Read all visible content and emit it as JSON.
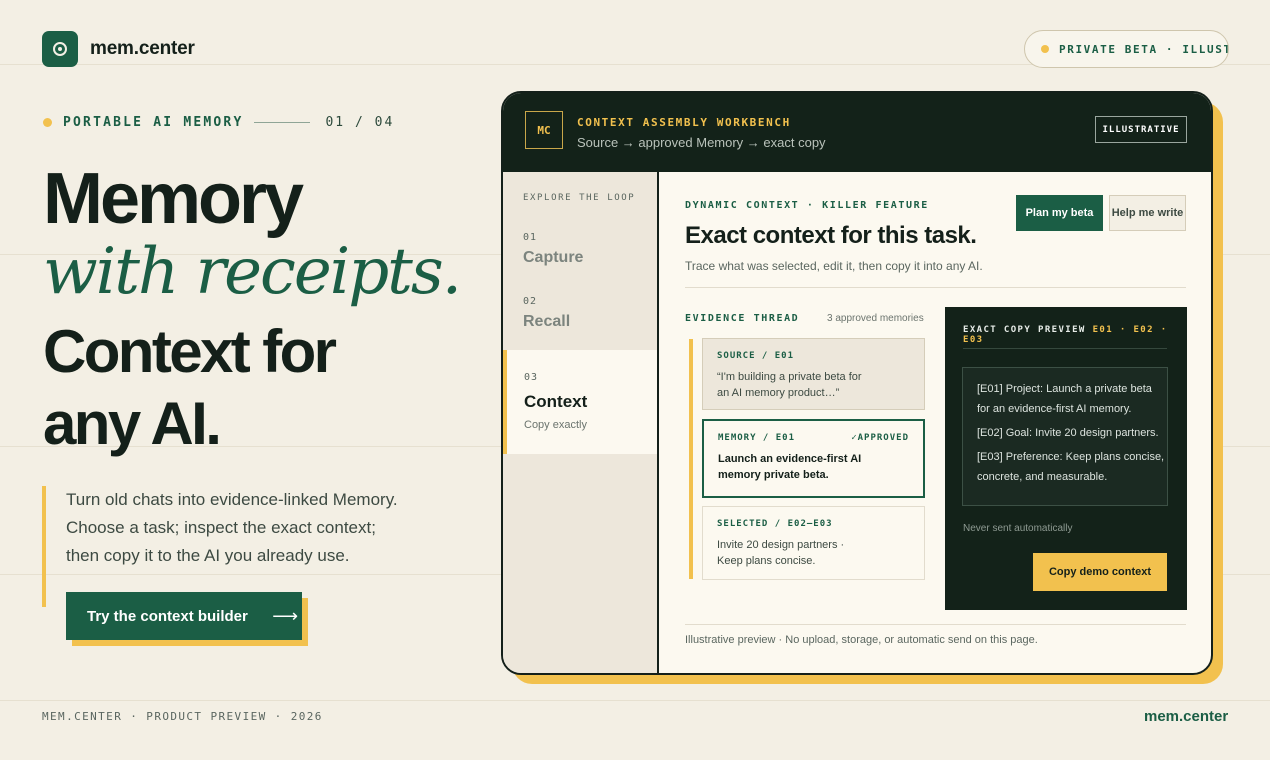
{
  "brand": {
    "name": "mem.center",
    "logo_icon": "target-dot-icon",
    "accent": "#1b5e45",
    "highlight": "#f2c14e"
  },
  "beta_pill": {
    "text": "PRIVATE BETA · ILLUSTRATIVE"
  },
  "hero": {
    "eyebrow": "PORTABLE AI MEMORY",
    "counter": "01 / 04",
    "headline_1": "Memory",
    "headline_2": "with receipts.",
    "headline_3": "Context for",
    "headline_4": "any AI.",
    "lead_lines": [
      "Turn old chats into evidence-linked Memory.",
      "Choose a task; inspect the exact context;",
      "then copy it to the AI you already use."
    ],
    "cta_label": "Try the context builder",
    "cta_arrow": "⟶"
  },
  "workbench": {
    "badge": "MC",
    "title": "CONTEXT ASSEMBLY WORKBENCH",
    "subtitle": "Source → approved Memory → exact copy",
    "illustrative": "ILLUSTRATIVE",
    "sidebar": {
      "heading": "EXPLORE THE LOOP",
      "steps": [
        {
          "num": "01",
          "name": "Capture"
        },
        {
          "num": "02",
          "name": "Recall"
        },
        {
          "num": "03",
          "name": "Context",
          "desc": "Copy exactly"
        }
      ]
    },
    "main": {
      "label": "DYNAMIC CONTEXT · KILLER FEATURE",
      "title": "Exact context for this task.",
      "subtitle": "Trace what was selected, edit it, then copy it into any AI.",
      "plan_button": "Plan my beta",
      "help_button": "Help me write",
      "evidence_label": "EVIDENCE THREAD",
      "evidence_count": "3 approved memories",
      "cards": {
        "source": {
          "tag": "SOURCE / E01",
          "body_1": "“I'm building a private beta for",
          "body_2": "an AI memory product…”"
        },
        "memory": {
          "tag": "MEMORY / E01",
          "status": "✓APPROVED",
          "body_1": "Launch an evidence-first AI",
          "body_2": "memory private beta."
        },
        "selected": {
          "tag": "SELECTED / E02–E03",
          "body_1": "Invite 20 design partners ·",
          "body_2": "Keep plans concise."
        }
      },
      "preview": {
        "heading": "EXACT COPY PREVIEW",
        "refs": "E01 · E02 · E03",
        "lines": [
          "[E01] Project: Launch a private beta",
          "for an evidence-first AI memory.",
          "[E02] Goal: Invite 20 design partners.",
          "[E03] Preference: Keep plans concise,",
          "concrete, and measurable."
        ],
        "note": "Never sent automatically",
        "copy_button": "Copy demo context"
      },
      "footer": "Illustrative preview · No upload, storage, or automatic send on this page."
    }
  },
  "footer": {
    "left": "MEM.CENTER · PRODUCT PREVIEW · 2026",
    "right": "mem.center"
  }
}
